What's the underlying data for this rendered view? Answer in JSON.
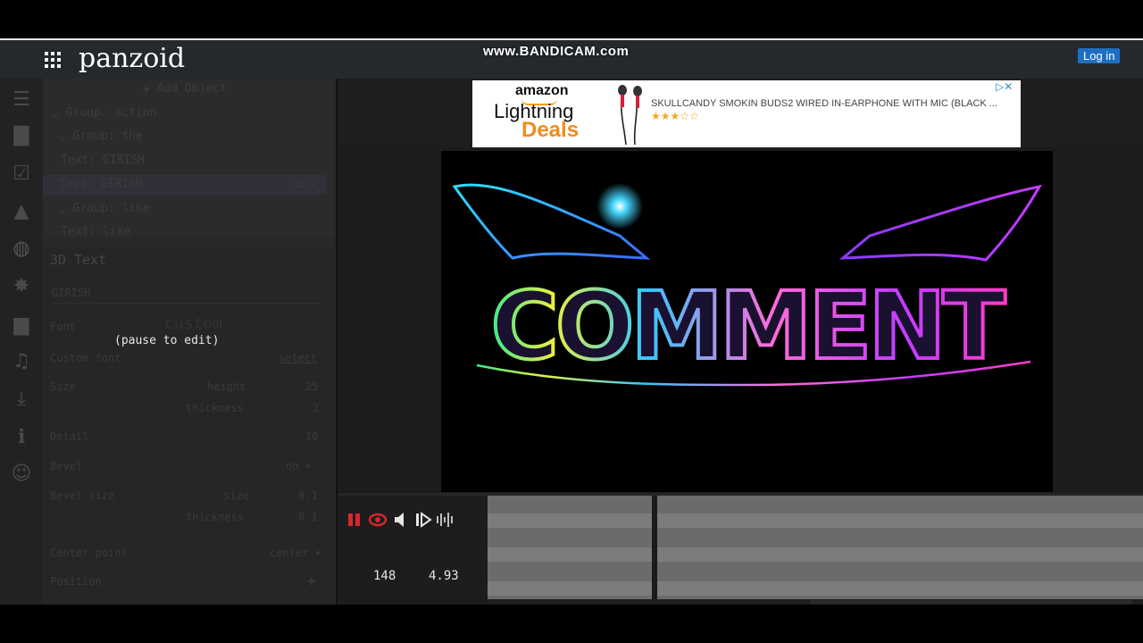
{
  "app": {
    "logo": "panzoid",
    "watermark": "www.BANDICAM.com",
    "login_label": "Log in"
  },
  "sidebar": {
    "add_object_label": "Add Object",
    "tree": [
      {
        "label": "Group: action"
      },
      {
        "label": "Group: the"
      },
      {
        "label": "Text: GIRISH"
      },
      {
        "label": "Text: GIRISH"
      },
      {
        "label": "Group: like"
      },
      {
        "label": "Text: like"
      }
    ],
    "properties": {
      "section_title": "3D Text",
      "text_value": "GIRISH",
      "font_label": "Font",
      "font_value": "custom",
      "custom_font_label": "Custom font",
      "custom_font_value": "select",
      "size_label": "Size",
      "height_label": "height",
      "height_value": "25",
      "thickness_label": "thickness",
      "thickness_value": "2",
      "detail_label": "Detail",
      "detail_value": "10",
      "bevel_label": "Bevel",
      "bevel_value": "on",
      "bevel_size_label": "Bevel size",
      "bevel_size_sub": "size",
      "bevel_size_value": "0.1",
      "bevel_thickness_sub": "thickness",
      "bevel_thickness_value": "0.1",
      "center_point_label": "Center point",
      "center_point_value": "center",
      "position_label": "Position"
    },
    "pause_message": "(pause to edit)"
  },
  "ad": {
    "brand": "amazon",
    "line1": "Lightning",
    "line2": "Deals",
    "product_text": "SKULLCANDY SMOKIN BUDS2 WIRED IN-EARPHONE WITH MIC (BLACK ...",
    "rating_stars": "★★★☆☆",
    "close_text": "▷✕"
  },
  "preview": {
    "title_text": "COMMENT"
  },
  "player": {
    "frame": "148",
    "time": "4.93"
  },
  "icons": {
    "left_bar": [
      "menu-icon",
      "folder-icon",
      "checkbox-icon",
      "image-icon",
      "sphere-icon",
      "burst-icon",
      "camera-icon",
      "music-icon",
      "download-icon",
      "info-icon",
      "smiley-icon"
    ]
  }
}
